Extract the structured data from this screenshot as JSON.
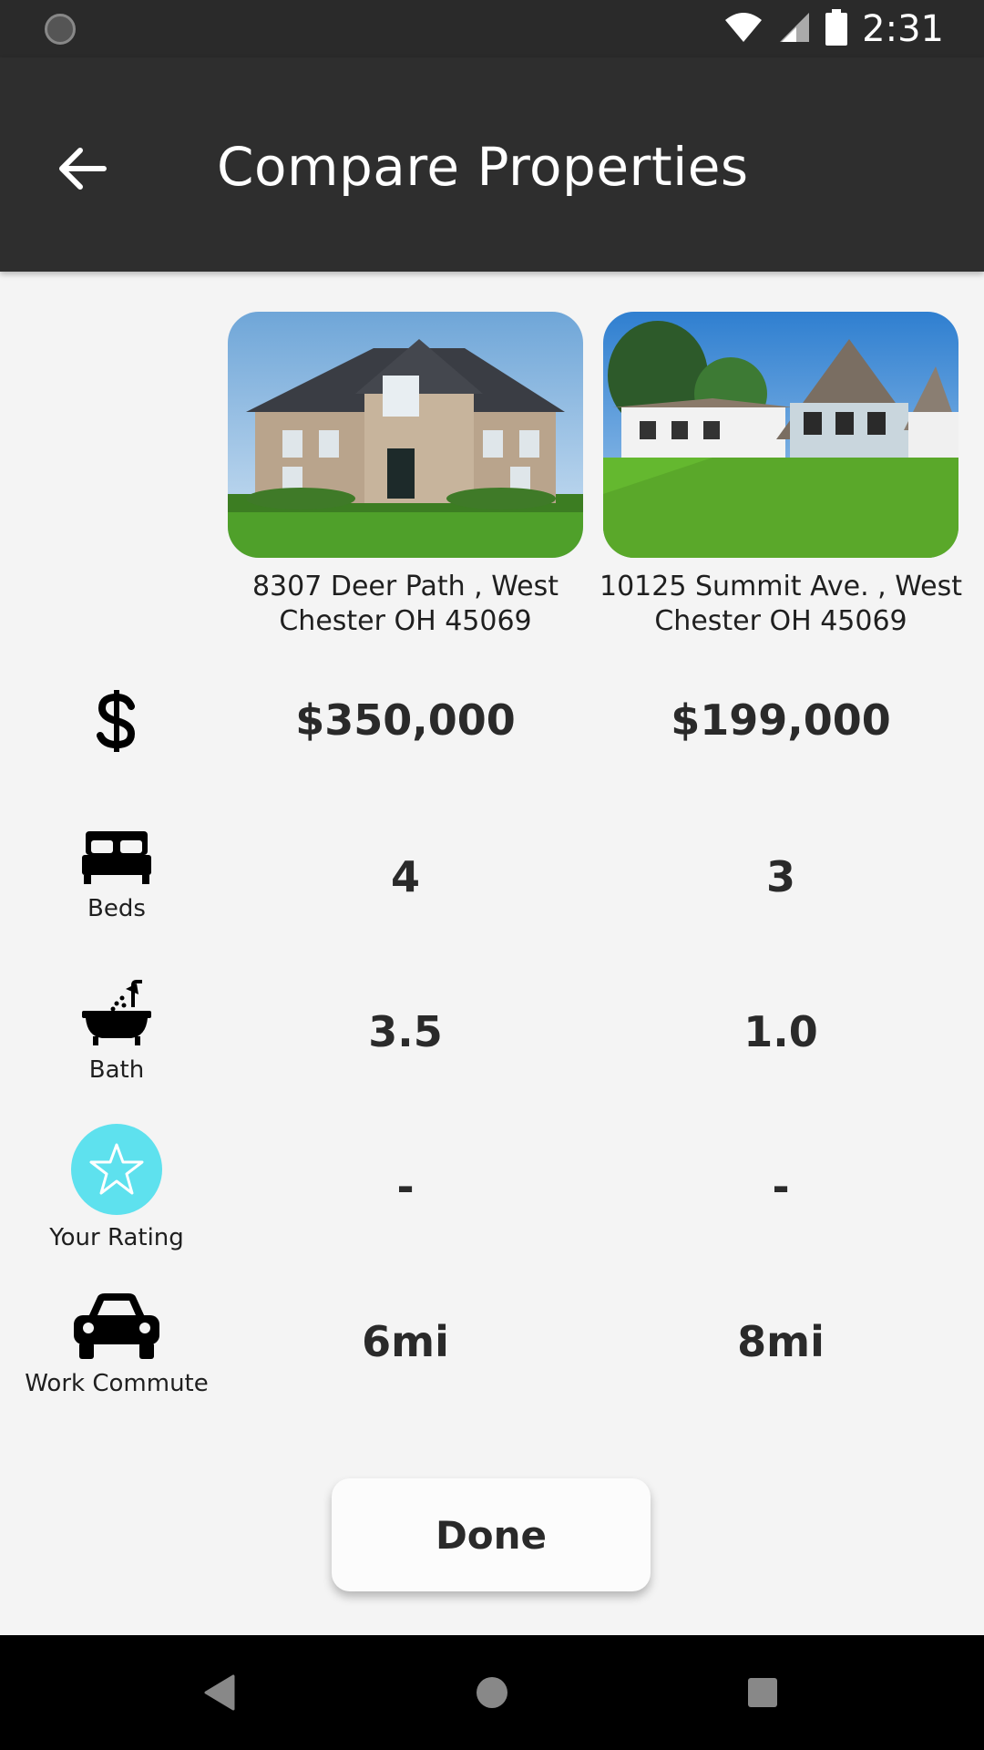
{
  "status_bar": {
    "time": "2:31",
    "icons": [
      "sync-icon",
      "wifi-icon",
      "signal-icon",
      "battery-icon"
    ]
  },
  "app_bar": {
    "title": "Compare Properties",
    "back_icon": "arrow-back-icon"
  },
  "properties": [
    {
      "address": "8307 Deer Path , West Chester OH 45069",
      "price": "$350,000",
      "beds": "4",
      "bath": "3.5",
      "rating": "-",
      "commute": "6mi"
    },
    {
      "address": "10125 Summit Ave. , West Chester OH 45069",
      "price": "$199,000",
      "beds": "3",
      "bath": "1.0",
      "rating": "-",
      "commute": "8mi"
    }
  ],
  "row_labels": {
    "price_icon": "dollar-icon",
    "beds": "Beds",
    "bath": "Bath",
    "rating": "Your Rating",
    "commute": "Work Commute"
  },
  "done_label": "Done",
  "colors": {
    "app_bar": "#2e2e2e",
    "background": "#f4f4f4",
    "rating_accent": "#5ee1ee"
  }
}
